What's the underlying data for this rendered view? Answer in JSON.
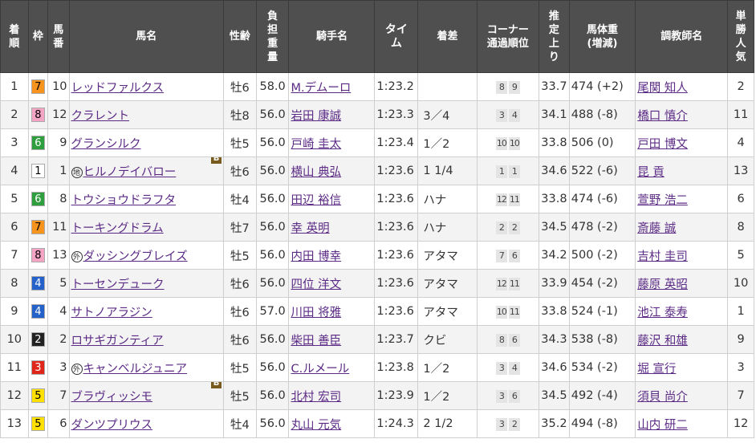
{
  "headers": {
    "rank": [
      "着",
      "順"
    ],
    "waku": "枠",
    "umaban": [
      "馬",
      "番"
    ],
    "horse": "馬名",
    "sexage": "性齢",
    "weight": [
      "負",
      "担",
      "重",
      "量"
    ],
    "jockey": "騎手名",
    "time": [
      "タイ",
      "ム"
    ],
    "margin": "着差",
    "corner": [
      "コーナー",
      "通過順位"
    ],
    "last3f": [
      "推",
      "定",
      "上",
      "り"
    ],
    "bodyweight": [
      "馬体重",
      "(増減)"
    ],
    "trainer": "調教師名",
    "pop": [
      "単",
      "勝",
      "人",
      "気"
    ]
  },
  "waku_colors": {
    "1": {
      "bg": "#ffffff",
      "fg": "#000000"
    },
    "2": {
      "bg": "#222222",
      "fg": "#ffffff"
    },
    "3": {
      "bg": "#e0261b",
      "fg": "#ffffff"
    },
    "4": {
      "bg": "#2461c8",
      "fg": "#ffffff"
    },
    "5": {
      "bg": "#ffe000",
      "fg": "#000000"
    },
    "6": {
      "bg": "#2e9e3e",
      "fg": "#ffffff"
    },
    "7": {
      "bg": "#f7941d",
      "fg": "#000000"
    },
    "8": {
      "bg": "#f5a5c4",
      "fg": "#000000"
    }
  },
  "rows": [
    {
      "rank": "1",
      "waku": "7",
      "umaban": "10",
      "mark": "",
      "horse": "レッドファルクス",
      "blinker": false,
      "sexage": "牡6",
      "weight": "58.0",
      "jockey": "M.デムーロ",
      "time": "1:23.2",
      "margin": "",
      "corner": [
        "8",
        "9"
      ],
      "last3f": "33.7",
      "bodyweight": "474 (+2)",
      "trainer": "尾関 知人",
      "pop": "2"
    },
    {
      "rank": "2",
      "waku": "8",
      "umaban": "12",
      "mark": "",
      "horse": "クラレント",
      "blinker": false,
      "sexage": "牡8",
      "weight": "56.0",
      "jockey": "岩田 康誠",
      "time": "1:23.3",
      "margin": "3／4",
      "corner": [
        "3",
        "4"
      ],
      "last3f": "34.1",
      "bodyweight": "488 (-8)",
      "trainer": "橋口 慎介",
      "pop": "11"
    },
    {
      "rank": "3",
      "waku": "6",
      "umaban": "9",
      "mark": "",
      "horse": "グランシルク",
      "blinker": false,
      "sexage": "牡5",
      "weight": "56.0",
      "jockey": "戸崎 圭太",
      "time": "1:23.4",
      "margin": "1／2",
      "corner": [
        "10",
        "10"
      ],
      "last3f": "33.8",
      "bodyweight": "506 (0)",
      "trainer": "戸田 博文",
      "pop": "4"
    },
    {
      "rank": "4",
      "waku": "1",
      "umaban": "1",
      "mark": "地",
      "horse": "ヒルノデイバロー",
      "blinker": true,
      "sexage": "牡6",
      "weight": "56.0",
      "jockey": "横山 典弘",
      "time": "1:23.6",
      "margin": "1 1/4",
      "corner": [
        "1",
        "1"
      ],
      "last3f": "34.6",
      "bodyweight": "522 (-6)",
      "trainer": "昆 貢",
      "pop": "13"
    },
    {
      "rank": "5",
      "waku": "6",
      "umaban": "8",
      "mark": "",
      "horse": "トウショウドラフタ",
      "blinker": false,
      "sexage": "牡4",
      "weight": "56.0",
      "jockey": "田辺 裕信",
      "time": "1:23.6",
      "margin": "ハナ",
      "corner": [
        "12",
        "11"
      ],
      "last3f": "33.8",
      "bodyweight": "474 (-6)",
      "trainer": "萱野 浩二",
      "pop": "6"
    },
    {
      "rank": "6",
      "waku": "7",
      "umaban": "11",
      "mark": "",
      "horse": "トーキングドラム",
      "blinker": false,
      "sexage": "牡7",
      "weight": "56.0",
      "jockey": "幸 英明",
      "time": "1:23.6",
      "margin": "ハナ",
      "corner": [
        "2",
        "2"
      ],
      "last3f": "34.5",
      "bodyweight": "478 (-2)",
      "trainer": "斎藤 誠",
      "pop": "8"
    },
    {
      "rank": "7",
      "waku": "8",
      "umaban": "13",
      "mark": "外",
      "horse": "ダッシングブレイズ",
      "blinker": false,
      "sexage": "牡5",
      "weight": "56.0",
      "jockey": "内田 博幸",
      "time": "1:23.6",
      "margin": "アタマ",
      "corner": [
        "7",
        "6"
      ],
      "last3f": "34.2",
      "bodyweight": "500 (-2)",
      "trainer": "吉村 圭司",
      "pop": "5"
    },
    {
      "rank": "8",
      "waku": "4",
      "umaban": "5",
      "mark": "",
      "horse": "トーセンデューク",
      "blinker": false,
      "sexage": "牡6",
      "weight": "56.0",
      "jockey": "四位 洋文",
      "time": "1:23.6",
      "margin": "アタマ",
      "corner": [
        "12",
        "11"
      ],
      "last3f": "33.9",
      "bodyweight": "454 (-2)",
      "trainer": "藤原 英昭",
      "pop": "10"
    },
    {
      "rank": "9",
      "waku": "4",
      "umaban": "4",
      "mark": "",
      "horse": "サトノアラジン",
      "blinker": false,
      "sexage": "牡6",
      "weight": "57.0",
      "jockey": "川田 将雅",
      "time": "1:23.6",
      "margin": "アタマ",
      "corner": [
        "10",
        "11"
      ],
      "last3f": "33.8",
      "bodyweight": "524 (-1)",
      "trainer": "池江 泰寿",
      "pop": "1"
    },
    {
      "rank": "10",
      "waku": "2",
      "umaban": "2",
      "mark": "",
      "horse": "ロサギガンティア",
      "blinker": false,
      "sexage": "牡6",
      "weight": "56.0",
      "jockey": "柴田 善臣",
      "time": "1:23.7",
      "margin": "クビ",
      "corner": [
        "8",
        "6"
      ],
      "last3f": "34.3",
      "bodyweight": "538 (-8)",
      "trainer": "藤沢 和雄",
      "pop": "9"
    },
    {
      "rank": "11",
      "waku": "3",
      "umaban": "3",
      "mark": "外",
      "horse": "キャンベルジュニア",
      "blinker": false,
      "sexage": "牡5",
      "weight": "56.0",
      "jockey": "C.ルメール",
      "time": "1:23.8",
      "margin": "1／2",
      "corner": [
        "3",
        "4"
      ],
      "last3f": "34.6",
      "bodyweight": "534 (-2)",
      "trainer": "堀 宣行",
      "pop": "3"
    },
    {
      "rank": "12",
      "waku": "5",
      "umaban": "7",
      "mark": "",
      "horse": "ブラヴィッシモ",
      "blinker": true,
      "sexage": "牡5",
      "weight": "56.0",
      "jockey": "北村 宏司",
      "time": "1:23.9",
      "margin": "1／2",
      "corner": [
        "3",
        "6"
      ],
      "last3f": "34.5",
      "bodyweight": "492 (-4)",
      "trainer": "須貝 尚介",
      "pop": "7"
    },
    {
      "rank": "13",
      "waku": "5",
      "umaban": "6",
      "mark": "",
      "horse": "ダンツプリウス",
      "blinker": false,
      "sexage": "牡4",
      "weight": "56.0",
      "jockey": "丸山 元気",
      "time": "1:24.3",
      "margin": "2 1/2",
      "corner": [
        "3",
        "2"
      ],
      "last3f": "35.2",
      "bodyweight": "494 (-8)",
      "trainer": "山内 研二",
      "pop": "12"
    }
  ],
  "blinker_label": "B"
}
